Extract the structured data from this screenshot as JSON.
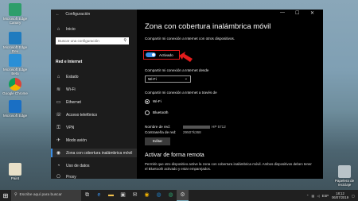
{
  "desktop_icons": [
    {
      "label": "Microsoft Edge Canary"
    },
    {
      "label": "Microsoft Edge Dev"
    },
    {
      "label": "Microsoft Edge Beta"
    },
    {
      "label": "Google Chrome"
    },
    {
      "label": "Microsoft Edge"
    },
    {
      "label": "Paint"
    },
    {
      "label": "Papelera de reciclaje"
    }
  ],
  "window": {
    "app_title": "Configuración",
    "back_arrow": "←",
    "nav": {
      "home": "Inicio",
      "search_placeholder": "Buscar una configuración",
      "section_header": "Red e Internet",
      "items": [
        {
          "label": "Estado",
          "icon": "⌂"
        },
        {
          "label": "Wi-Fi",
          "icon": "≋"
        },
        {
          "label": "Ethernet",
          "icon": "▭"
        },
        {
          "label": "Acceso telefónico",
          "icon": "☏"
        },
        {
          "label": "VPN",
          "icon": "⚿"
        },
        {
          "label": "Modo avión",
          "icon": "✈"
        },
        {
          "label": "Zona con cobertura inalámbrica móvil",
          "icon": "◉"
        },
        {
          "label": "Uso de datos",
          "icon": "◔"
        },
        {
          "label": "Proxy",
          "icon": "⎔"
        }
      ]
    },
    "controls": {
      "minimize": "—",
      "maximize": "☐",
      "close": "✕"
    },
    "content": {
      "title": "Zona con cobertura inalámbrica móvil",
      "share_label": "Compartir mi conexión a Internet con otros dispositivos.",
      "toggle_state": "Activado",
      "share_from_label": "Compartir mi conexión a Internet desde",
      "share_from_value": "Wi-Fi",
      "share_via_label": "Compartir mi conexión a Internet a través de",
      "via_options": [
        {
          "label": "Wi-Fi",
          "selected": true
        },
        {
          "label": "Bluetooth",
          "selected": false
        }
      ],
      "network_name_label": "Nombre de red:",
      "network_name_value": "HP 5712",
      "password_label": "Contraseña de red:",
      "password_value": "29507k368",
      "edit_button": "Editar",
      "remote_title": "Activar de forma remota",
      "remote_text": "Permitir que otro dispositivo active la zona con cobertura inalámbrica móvil. Ambos dispositivos deben tener el Bluetooth activado y estar emparejados."
    }
  },
  "taskbar": {
    "search_placeholder": "Escribe aquí para buscar",
    "language": "ESP",
    "time": "18:12",
    "date": "06/07/2019"
  },
  "colors": {
    "accent": "#3a8ee6",
    "highlight": "#e21c1c"
  }
}
